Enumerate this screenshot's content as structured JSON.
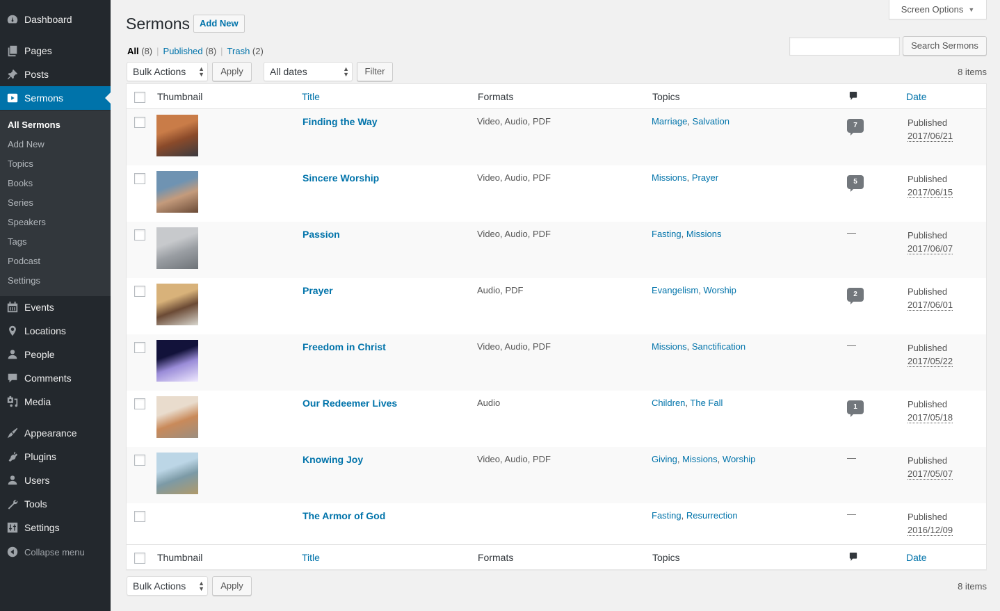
{
  "sidebar": {
    "items": [
      {
        "label": "Dashboard",
        "icon": "dashboard-icon"
      },
      {
        "label": "Pages",
        "icon": "pages-icon"
      },
      {
        "label": "Posts",
        "icon": "pin-icon"
      },
      {
        "label": "Sermons",
        "icon": "video-icon",
        "current": true
      },
      {
        "label": "Events",
        "icon": "calendar-icon"
      },
      {
        "label": "Locations",
        "icon": "location-icon"
      },
      {
        "label": "People",
        "icon": "person-icon"
      },
      {
        "label": "Comments",
        "icon": "comment-icon"
      },
      {
        "label": "Media",
        "icon": "media-icon"
      },
      {
        "label": "Appearance",
        "icon": "brush-icon"
      },
      {
        "label": "Plugins",
        "icon": "plug-icon"
      },
      {
        "label": "Users",
        "icon": "user-icon"
      },
      {
        "label": "Tools",
        "icon": "wrench-icon"
      },
      {
        "label": "Settings",
        "icon": "sliders-icon"
      }
    ],
    "submenu": [
      "All Sermons",
      "Add New",
      "Topics",
      "Books",
      "Series",
      "Speakers",
      "Tags",
      "Podcast",
      "Settings"
    ],
    "collapse_label": "Collapse menu"
  },
  "header": {
    "title": "Sermons",
    "add_new": "Add New",
    "screen_options": "Screen Options"
  },
  "views": {
    "all": {
      "label": "All",
      "count": "(8)"
    },
    "published": {
      "label": "Published",
      "count": "(8)"
    },
    "trash": {
      "label": "Trash",
      "count": "(2)"
    },
    "separator": "|"
  },
  "search": {
    "value": "",
    "button": "Search Sermons"
  },
  "tablenav": {
    "bulk_actions": "Bulk Actions",
    "apply": "Apply",
    "all_dates": "All dates",
    "filter": "Filter",
    "items_count": "8 items"
  },
  "columns": {
    "thumbnail": "Thumbnail",
    "title": "Title",
    "formats": "Formats",
    "topics": "Topics",
    "comments_icon": "comment-icon",
    "date": "Date"
  },
  "rows": [
    {
      "title": "Finding the Way",
      "formats": "Video, Audio, PDF",
      "topics": [
        "Marriage",
        "Salvation"
      ],
      "comments": "7",
      "status": "Published",
      "date": "2017/06/21",
      "thumb": [
        "#c97c48",
        "#8a4a2a",
        "#3b3b40"
      ]
    },
    {
      "title": "Sincere Worship",
      "formats": "Video, Audio, PDF",
      "topics": [
        "Missions",
        "Prayer"
      ],
      "comments": "5",
      "status": "Published",
      "date": "2017/06/15",
      "thumb": [
        "#6f93b2",
        "#c49b7c",
        "#6a4a36"
      ]
    },
    {
      "title": "Passion",
      "formats": "Video, Audio, PDF",
      "topics": [
        "Fasting",
        "Missions"
      ],
      "comments": "—",
      "status": "Published",
      "date": "2017/06/07",
      "thumb": [
        "#c7c9cc",
        "#9a9ea3",
        "#6e7378"
      ]
    },
    {
      "title": "Prayer",
      "formats": "Audio, PDF",
      "topics": [
        "Evangelism",
        "Worship"
      ],
      "comments": "2",
      "status": "Published",
      "date": "2017/06/01",
      "thumb": [
        "#d8b27a",
        "#6b4a35",
        "#d9d7cf"
      ]
    },
    {
      "title": "Freedom in Christ",
      "formats": "Video, Audio, PDF",
      "topics": [
        "Missions",
        "Sanctification"
      ],
      "comments": "—",
      "status": "Published",
      "date": "2017/05/22",
      "thumb": [
        "#12123a",
        "#9a8cd8",
        "#f0eaff"
      ]
    },
    {
      "title": "Our Redeemer Lives",
      "formats": "Audio",
      "topics": [
        "Children",
        "The Fall"
      ],
      "comments": "1",
      "status": "Published",
      "date": "2017/05/18",
      "thumb": [
        "#e9dccd",
        "#c98a5a",
        "#9b8e80"
      ]
    },
    {
      "title": "Knowing Joy",
      "formats": "Video, Audio, PDF",
      "topics": [
        "Giving",
        "Missions",
        "Worship"
      ],
      "comments": "—",
      "status": "Published",
      "date": "2017/05/07",
      "thumb": [
        "#bcd6e6",
        "#7c9aa6",
        "#b09a6a"
      ]
    },
    {
      "title": "The Armor of God",
      "formats": "",
      "topics": [
        "Fasting",
        "Resurrection"
      ],
      "comments": "—",
      "status": "Published",
      "date": "2016/12/09",
      "thumb": null
    }
  ]
}
